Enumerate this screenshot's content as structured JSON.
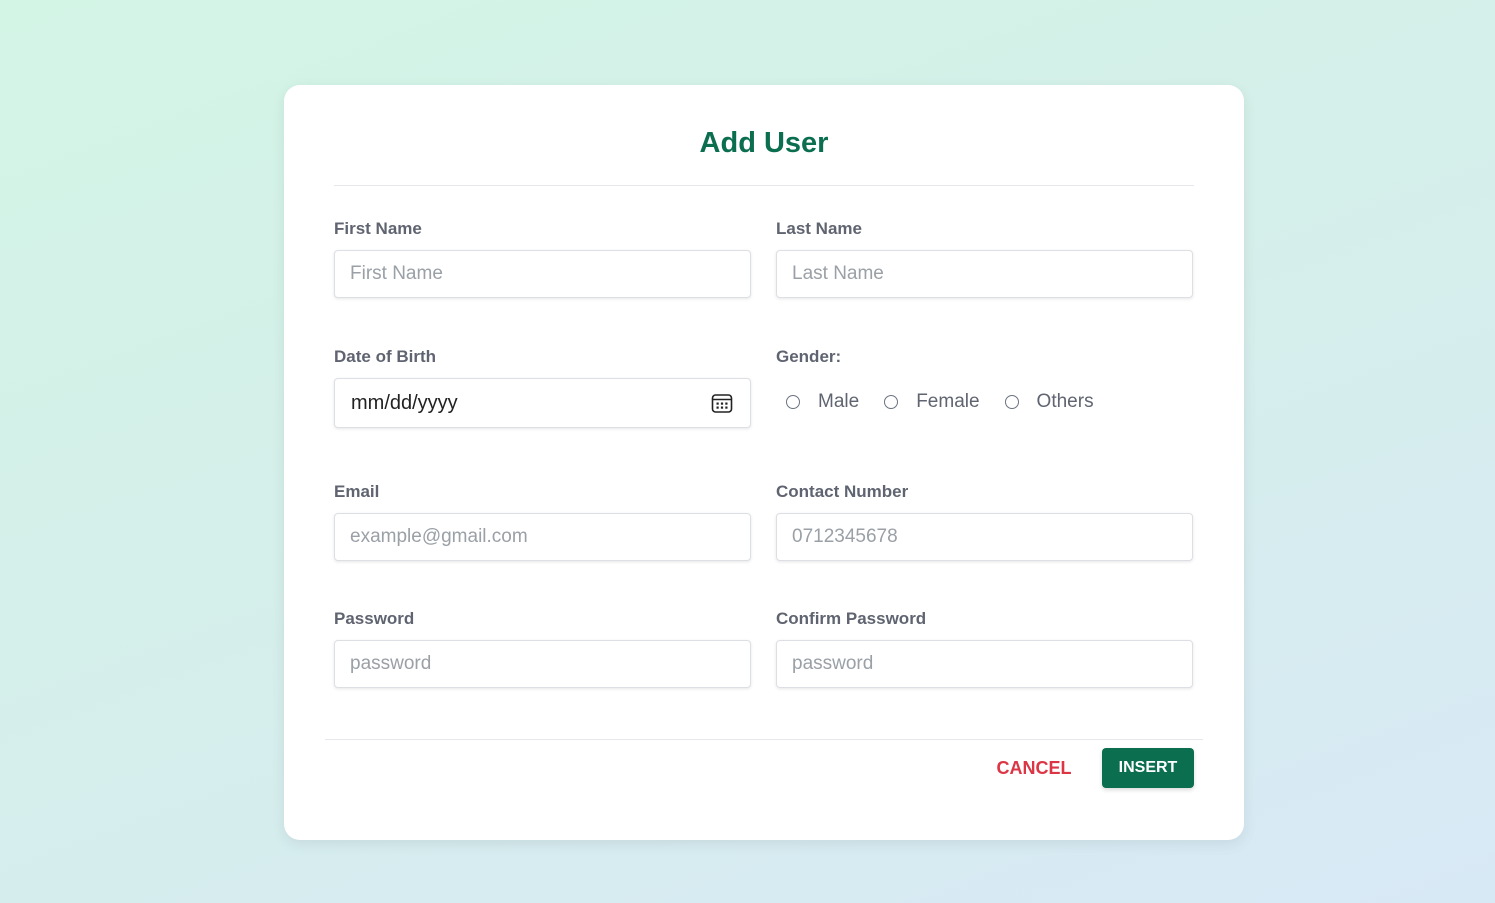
{
  "form": {
    "title": "Add User",
    "first_name": {
      "label": "First Name",
      "placeholder": "First Name"
    },
    "last_name": {
      "label": "Last Name",
      "placeholder": "Last Name"
    },
    "dob": {
      "label": "Date of Birth",
      "placeholder": "mm/dd/yyyy"
    },
    "gender": {
      "label": "Gender:",
      "options": [
        "Male",
        "Female",
        "Others"
      ]
    },
    "email": {
      "label": "Email",
      "placeholder": "example@gmail.com"
    },
    "contact": {
      "label": "Contact Number",
      "placeholder": "0712345678"
    },
    "password": {
      "label": "Password",
      "placeholder": "password"
    },
    "confirm_password": {
      "label": "Confirm Password",
      "placeholder": "password"
    },
    "cancel_label": "CANCEL",
    "insert_label": "INSERT"
  },
  "colors": {
    "accent": "#0b6e4f",
    "danger": "#dc3545"
  },
  "icons": {
    "date": "calendar-icon"
  }
}
